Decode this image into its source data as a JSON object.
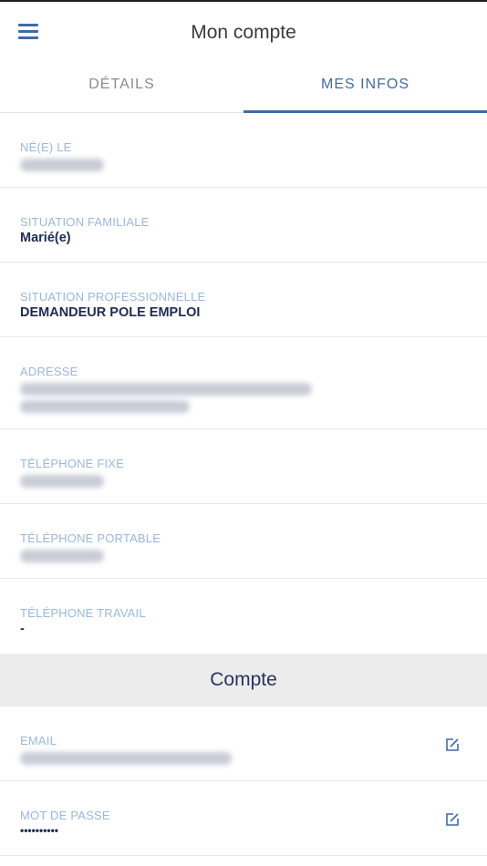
{
  "header": {
    "title": "Mon compte",
    "menu_icon": "menu-icon"
  },
  "tabs": [
    {
      "label": "DÉTAILS",
      "active": false
    },
    {
      "label": "MES INFOS",
      "active": true
    }
  ],
  "personal": {
    "birth": {
      "label": "NÉ(E) LE"
    },
    "family": {
      "label": "SITUATION FAMILIALE",
      "value": "Marié(e)"
    },
    "professional": {
      "label": "SITUATION PROFESSIONNELLE",
      "value": "DEMANDEUR POLE EMPLOI"
    },
    "address": {
      "label": "ADRESSE"
    },
    "phone_home": {
      "label": "TÉLÉPHONE FIXE"
    },
    "phone_mobile": {
      "label": "TÉLÉPHONE PORTABLE"
    },
    "phone_work": {
      "label": "TÉLÉPHONE TRAVAIL",
      "value": "-"
    }
  },
  "account": {
    "title": "Compte",
    "email": {
      "label": "EMAIL",
      "edit_icon": "edit-icon"
    },
    "password": {
      "label": "MOT DE PASSE",
      "value": "••••••••••",
      "edit_icon": "edit-icon"
    }
  },
  "colors": {
    "accent": "#3f6aa8",
    "label": "#9ab8dc",
    "value": "#1f2a55",
    "group_bg": "#ececec"
  }
}
